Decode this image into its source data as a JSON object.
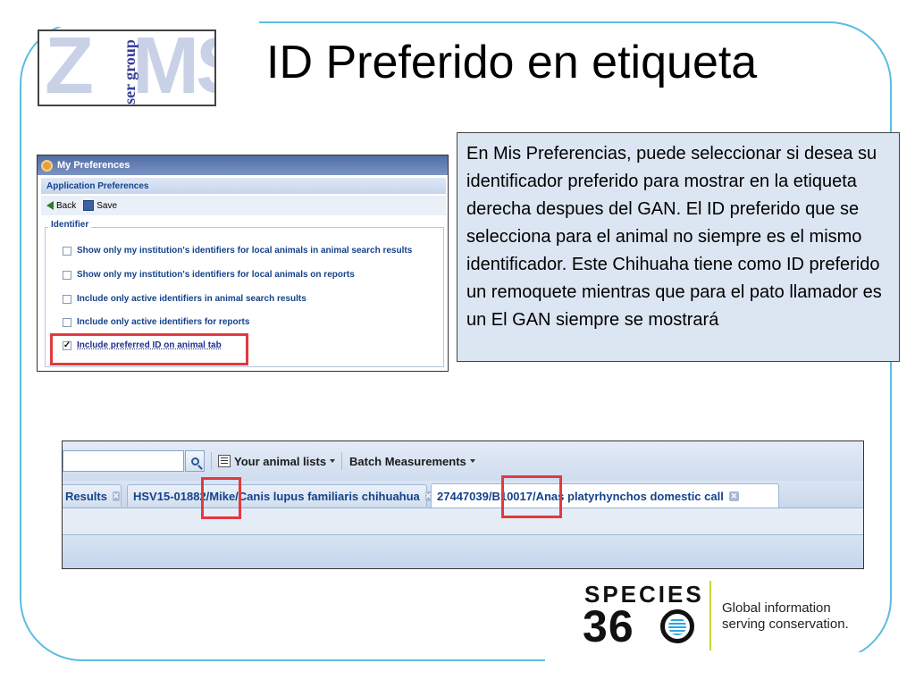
{
  "slide": {
    "title": "ID Preferido en etiqueta"
  },
  "zims_logo": {
    "letters_left": "Z",
    "letters_right": "MS",
    "vertical_text": "user group"
  },
  "preferences": {
    "window_title": "My Preferences",
    "section_header": "Application Preferences",
    "toolbar": {
      "back_label": "Back",
      "save_label": "Save"
    },
    "group_label": "Identifier",
    "options": [
      {
        "label": "Show only my institution's identifiers for local animals in animal search results",
        "checked": false
      },
      {
        "label": "Show only my institution's identifiers for local animals on reports",
        "checked": false
      },
      {
        "label": "Include only active identifiers in animal search results",
        "checked": false
      },
      {
        "label": "Include only active identifiers for reports",
        "checked": false
      },
      {
        "label": "Include preferred ID on animal tab",
        "checked": true
      }
    ],
    "check_mark": "✓"
  },
  "callout": {
    "text": "En Mis Preferencias, puede seleccionar si desea su identificador preferido para mostrar en la etiqueta derecha despues del GAN. El ID preferido que se selecciona para el animal no siempre es el mismo identificador. Este Chihuaha tiene como ID preferido un remoquete mientras que para el pato llamador es un El GAN siempre se mostrará"
  },
  "animal_tabs": {
    "toolbar": {
      "lists_label": "Your animal lists",
      "batch_label": "Batch Measurements"
    },
    "tabs": [
      {
        "label": "Results",
        "active": false
      },
      {
        "label": "HSV15-01882/Mike/Canis lupus familiaris chihuahua",
        "active": false
      },
      {
        "label": "27447039/B10017/Anas platyrhynchos domestic call",
        "active": true
      }
    ],
    "close_glyph": "✕"
  },
  "species360": {
    "word": "SPECIES",
    "number_left": "3",
    "number_mid": "6",
    "tagline_line1": "Global information",
    "tagline_line2": "serving conservation."
  },
  "colors": {
    "frame": "#5bbde0",
    "highlight": "#e3393e",
    "callout_bg": "#dce6f2",
    "accent_green": "#c7d53a"
  },
  "icons": [
    "gear-icon",
    "back-arrow-icon",
    "save-disk-icon",
    "search-icon",
    "list-icon",
    "dropdown-caret-icon",
    "close-icon",
    "globe-icon"
  ]
}
